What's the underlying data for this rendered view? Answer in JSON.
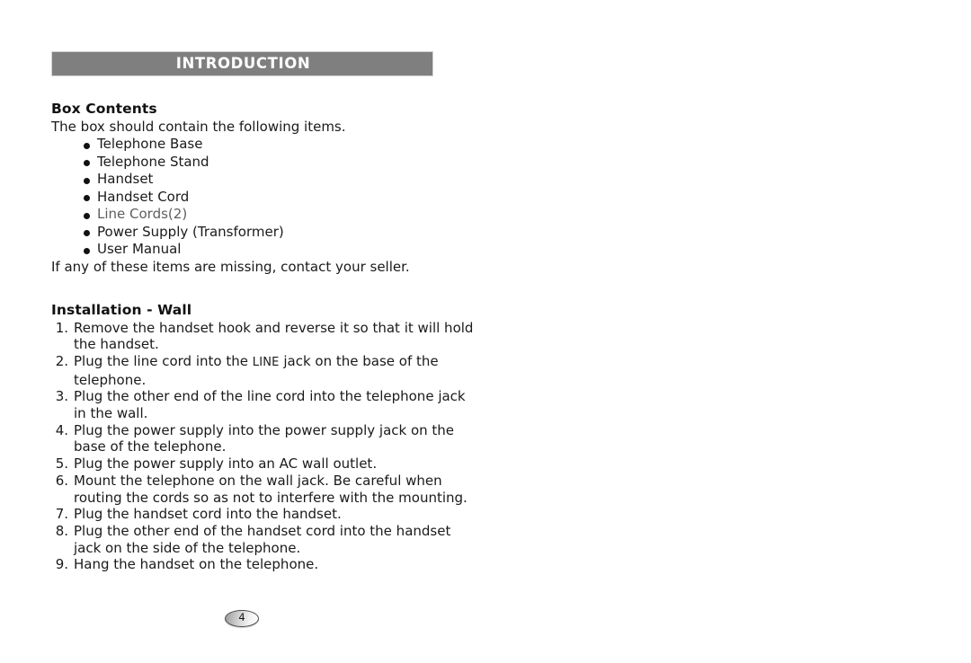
{
  "section_header": {
    "title": "INTRODUCTION",
    "bar_color": "#7f7f7f",
    "text_color": "#ffffff"
  },
  "box_contents": {
    "heading": "Box Contents",
    "intro_line": "The box should contain the following items.",
    "items": [
      {
        "label": "Telephone Base",
        "faint": false
      },
      {
        "label": "Telephone Stand",
        "faint": false
      },
      {
        "label": "Handset",
        "faint": false
      },
      {
        "label": "Handset Cord",
        "faint": false
      },
      {
        "label": "Line Cords(2)",
        "faint": true
      },
      {
        "label": "Power Supply (Transformer)",
        "faint": false
      },
      {
        "label": "User Manual",
        "faint": false
      }
    ],
    "closing_line": "If any of these items are missing, contact your seller."
  },
  "installation": {
    "heading": "Installation - Wall",
    "steps": [
      {
        "num": "1.",
        "text": "Remove the handset hook and reverse it so that it will hold the handset."
      },
      {
        "num": "2.",
        "text_before": "Plug the line cord into the ",
        "smallcaps": "LINE",
        "text_after": " jack on the base of the telephone."
      },
      {
        "num": "3.",
        "text": "Plug the other end of the line cord into the telephone jack in the wall."
      },
      {
        "num": "4.",
        "text": "Plug the power supply into the power supply jack on the base of the telephone."
      },
      {
        "num": "5.",
        "text": "Plug the power supply into an AC wall outlet."
      },
      {
        "num": "6.",
        "text": "Mount the telephone on the wall jack.  Be careful when routing the cords so as not to interfere with the mounting."
      },
      {
        "num": "7.",
        "text": "Plug the handset cord into the handset."
      },
      {
        "num": "8.",
        "text": "Plug the other end of the handset cord into the handset jack on the side of the telephone."
      },
      {
        "num": "9.",
        "text": "Hang the handset on the telephone."
      }
    ]
  },
  "footer": {
    "page_number": "4"
  }
}
